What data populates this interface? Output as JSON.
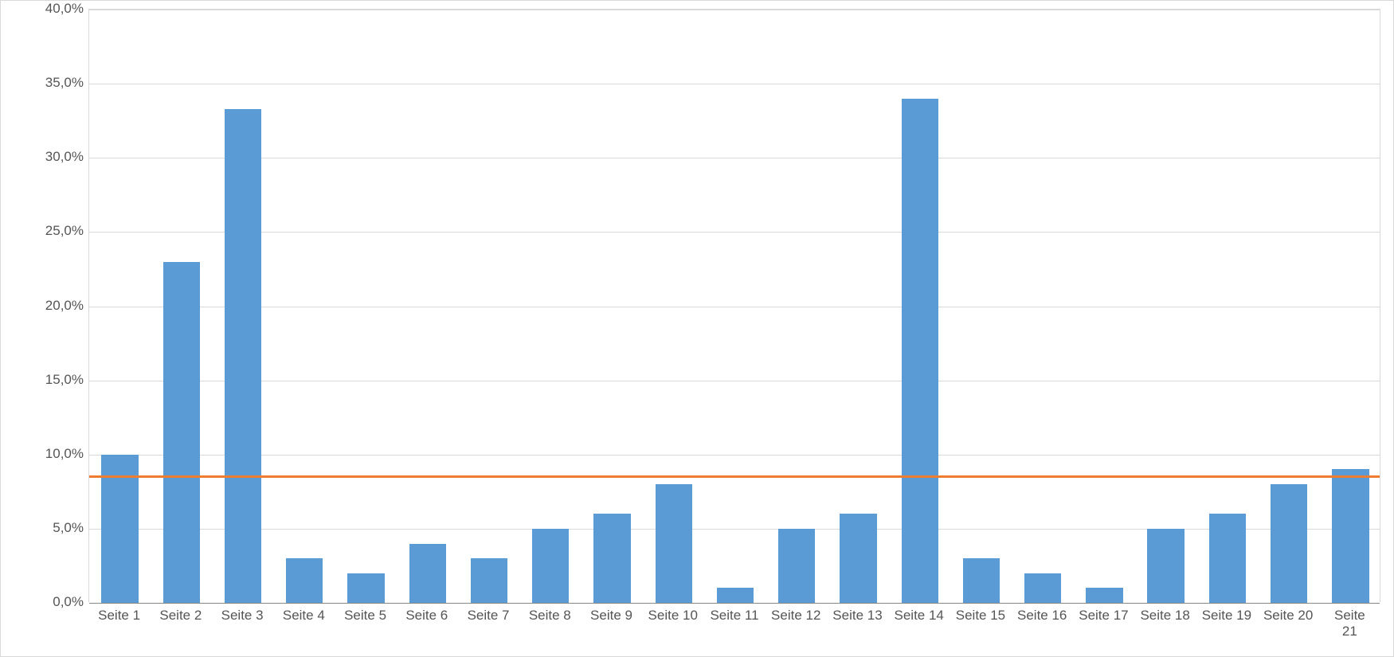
{
  "chart_data": {
    "type": "bar",
    "categories": [
      "Seite 1",
      "Seite 2",
      "Seite 3",
      "Seite 4",
      "Seite 5",
      "Seite 6",
      "Seite 7",
      "Seite 8",
      "Seite 9",
      "Seite 10",
      "Seite 11",
      "Seite 12",
      "Seite 13",
      "Seite 14",
      "Seite 15",
      "Seite 16",
      "Seite 17",
      "Seite 18",
      "Seite 19",
      "Seite 20",
      "Seite 21"
    ],
    "values": [
      10.0,
      23.0,
      33.3,
      3.0,
      2.0,
      4.0,
      3.0,
      5.0,
      6.0,
      8.0,
      1.0,
      5.0,
      6.0,
      34.0,
      3.0,
      2.0,
      1.0,
      5.0,
      6.0,
      8.0,
      9.0
    ],
    "reference_line": 8.5,
    "ylim": [
      0,
      40
    ],
    "ytick_step": 5,
    "ytick_labels": [
      "0,0%",
      "5,0%",
      "10,0%",
      "15,0%",
      "20,0%",
      "25,0%",
      "30,0%",
      "35,0%",
      "40,0%"
    ],
    "title": "",
    "xlabel": "",
    "ylabel": "",
    "colors": {
      "bar": "#5b9bd5",
      "reference_line": "#ed7d31",
      "grid": "#d9d9d9"
    },
    "number_format": "de-DE-percent"
  }
}
